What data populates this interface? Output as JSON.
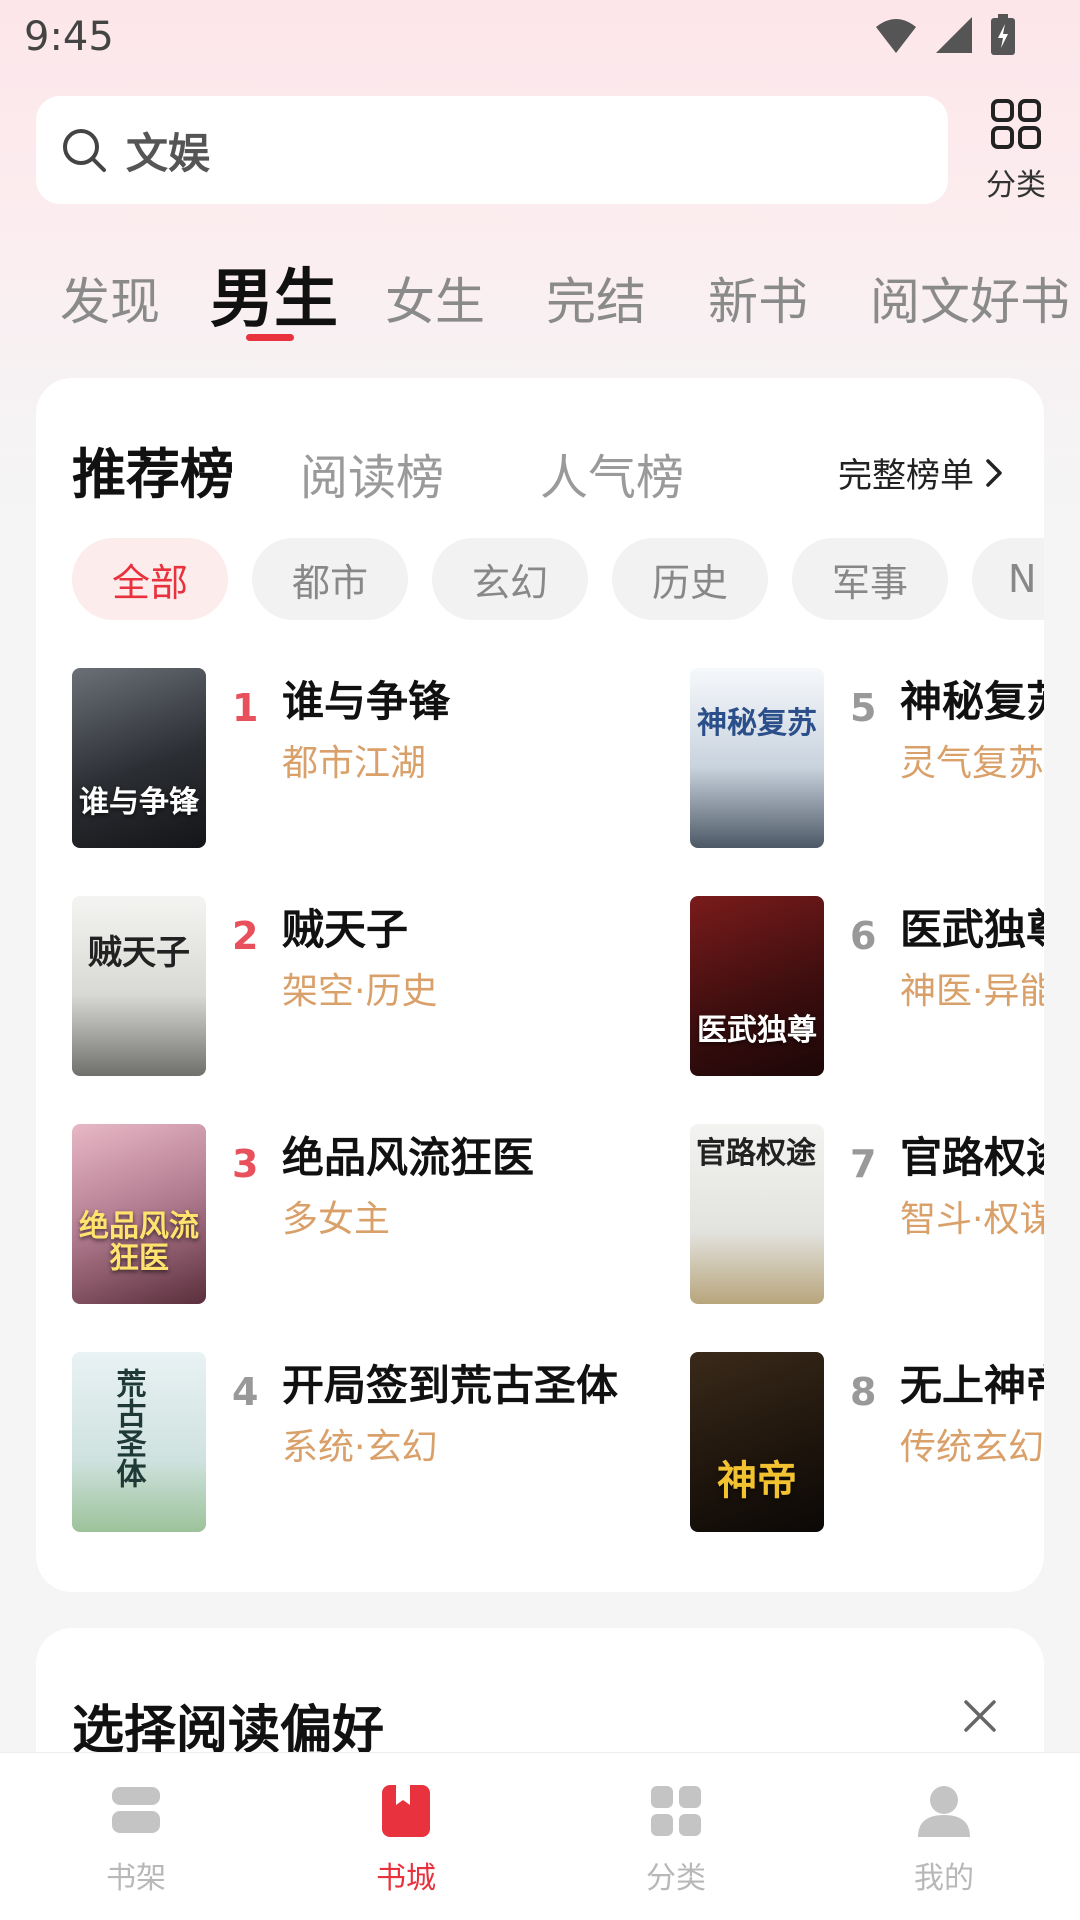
{
  "status": {
    "time": "9:45"
  },
  "search": {
    "text": "文娱",
    "category_label": "分类"
  },
  "top_tabs": [
    {
      "label": "发现"
    },
    {
      "label": "男生"
    },
    {
      "label": "女生"
    },
    {
      "label": "完结"
    },
    {
      "label": "新书"
    },
    {
      "label": "阅文好书"
    }
  ],
  "ranking": {
    "tabs": [
      {
        "label": "推荐榜"
      },
      {
        "label": "阅读榜"
      },
      {
        "label": "人气榜"
      }
    ],
    "full_list_label": "完整榜单",
    "chips": [
      {
        "label": "全部"
      },
      {
        "label": "都市"
      },
      {
        "label": "玄幻"
      },
      {
        "label": "历史"
      },
      {
        "label": "军事"
      },
      {
        "label": "N"
      }
    ],
    "books": [
      {
        "rank": "1",
        "title": "谁与争锋",
        "tag": "都市江湖",
        "cover_text": "谁与争锋"
      },
      {
        "rank": "2",
        "title": "贼天子",
        "tag": "架空·历史",
        "cover_text": "贼天子"
      },
      {
        "rank": "3",
        "title": "绝品风流狂医",
        "tag": "多女主",
        "cover_text": "绝品风流狂医"
      },
      {
        "rank": "4",
        "title": "开局签到荒古圣体",
        "tag": "系统·玄幻",
        "cover_text": "荒古圣体"
      },
      {
        "rank": "5",
        "title": "神秘复苏",
        "tag": "灵气复苏",
        "cover_text": "神秘复苏"
      },
      {
        "rank": "6",
        "title": "医武独尊",
        "tag": "神医·异能",
        "cover_text": "医武独尊"
      },
      {
        "rank": "7",
        "title": "官路权途",
        "tag": "智斗·权谋",
        "cover_text": "官路权途"
      },
      {
        "rank": "8",
        "title": "无上神帝",
        "tag": "传统玄幻",
        "cover_text": "神帝"
      }
    ]
  },
  "preference": {
    "title": "选择阅读偏好"
  },
  "bottom_nav": [
    {
      "label": "书架"
    },
    {
      "label": "书城"
    },
    {
      "label": "分类"
    },
    {
      "label": "我的"
    }
  ],
  "colors": {
    "accent": "#e8333e",
    "tag": "#d9a06a",
    "rank_hot": "#e8505b"
  }
}
